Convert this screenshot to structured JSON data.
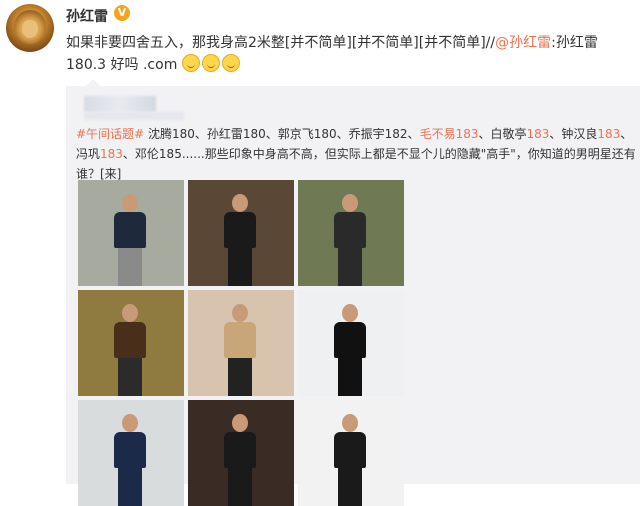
{
  "user": {
    "name": "孙红雷",
    "verified_badge": "V"
  },
  "post": {
    "text_1": "如果非要四舍五入，那我身高2米整[并不简单][并不简单][并不简单]//",
    "mention": "@孙红雷",
    "text_2": ":孙红雷 180.3 好吗 ",
    "link": ".com",
    "emojis": [
      "smile-emoji",
      "smile-emoji",
      "smile-emoji"
    ]
  },
  "repost": {
    "hashtag": "#午间话题#",
    "seg_1": " 沈腾180、孙红雷180、郭京飞180、乔振宇182、",
    "hl_1": "毛不易183",
    "seg_2": "、白敬亭",
    "hl_2": "183",
    "seg_3": "、钟汉良",
    "hl_3": "183",
    "seg_4": "、冯巩",
    "hl_4": "183",
    "seg_5": "、邓伦185......那些印象中身高不高，但实际上都是不显个儿的隐藏\"高手\"，你知道的男明星还有谁？[来]"
  },
  "photos": [
    {
      "bg": "#a6aa9f",
      "suit": "#1e2a3c",
      "pants": "#8a8a8a"
    },
    {
      "bg": "#5b4736",
      "suit": "#1a1a1a",
      "pants": "#1a1a1a"
    },
    {
      "bg": "#6f7a55",
      "suit": "#2a2a2a",
      "pants": "#2a2a2a"
    },
    {
      "bg": "#8f7a3f",
      "suit": "#4a2e1c",
      "pants": "#2b2b2b"
    },
    {
      "bg": "#d8c3ae",
      "suit": "#c9a57a",
      "pants": "#222222"
    },
    {
      "bg": "#eef0f1",
      "suit": "#111111",
      "pants": "#111111"
    },
    {
      "bg": "#d9dcdc",
      "suit": "#1c2a4a",
      "pants": "#1c2a4a"
    },
    {
      "bg": "#3a2b24",
      "suit": "#1a1a1a",
      "pants": "#1a1a1a"
    },
    {
      "bg": "#f2f2f2",
      "suit": "#1a1a1a",
      "pants": "#1a1a1a"
    }
  ],
  "colors": {
    "accent": "#eb7350",
    "repost_bg": "#f2f2f5"
  }
}
